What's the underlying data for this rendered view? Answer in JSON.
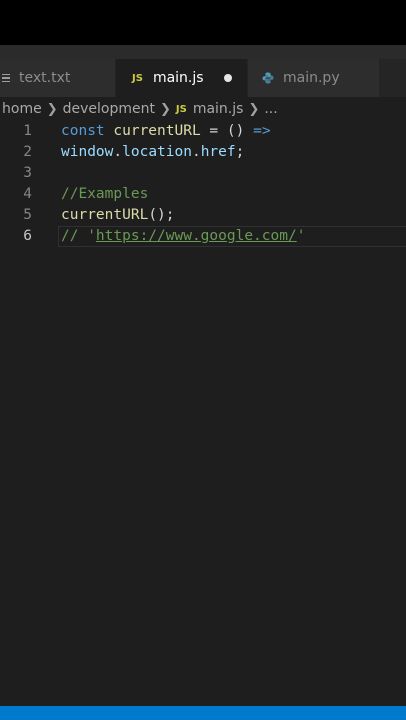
{
  "tabs": [
    {
      "label": "text.txt",
      "icon": "lines-icon",
      "active": false
    },
    {
      "label": "main.js",
      "icon": "js-icon",
      "icon_text": "JS",
      "active": true,
      "modified": true
    },
    {
      "label": "main.py",
      "icon": "python-icon",
      "active": false
    }
  ],
  "breadcrumb": {
    "items": [
      "home",
      "development",
      "main.js",
      "..."
    ],
    "js_icon_text": "JS"
  },
  "editor": {
    "line_numbers": [
      "1",
      "2",
      "3",
      "4",
      "5",
      "6"
    ],
    "current_line": 6,
    "lines": {
      "l1": {
        "keyword": "const",
        "name": "currentURL",
        "rest": " = () ",
        "arrow": "=>"
      },
      "l2": {
        "obj": "window",
        "dot1": ".",
        "prop1": "location",
        "dot2": ".",
        "prop2": "href",
        "semi": ";"
      },
      "l3": {},
      "l4": {
        "comment": "//Examples"
      },
      "l5": {
        "call": "currentURL",
        "rest": "();"
      },
      "l6": {
        "prefix": "// '",
        "url": "https://www.google.com/",
        "suffix": "'"
      }
    }
  },
  "colors": {
    "editor_bg": "#1e1e1e",
    "keyword": "#569cd6",
    "function": "#dcdcaa",
    "variable": "#9cdcfe",
    "comment": "#6a9955",
    "status_bar": "#007acc"
  }
}
